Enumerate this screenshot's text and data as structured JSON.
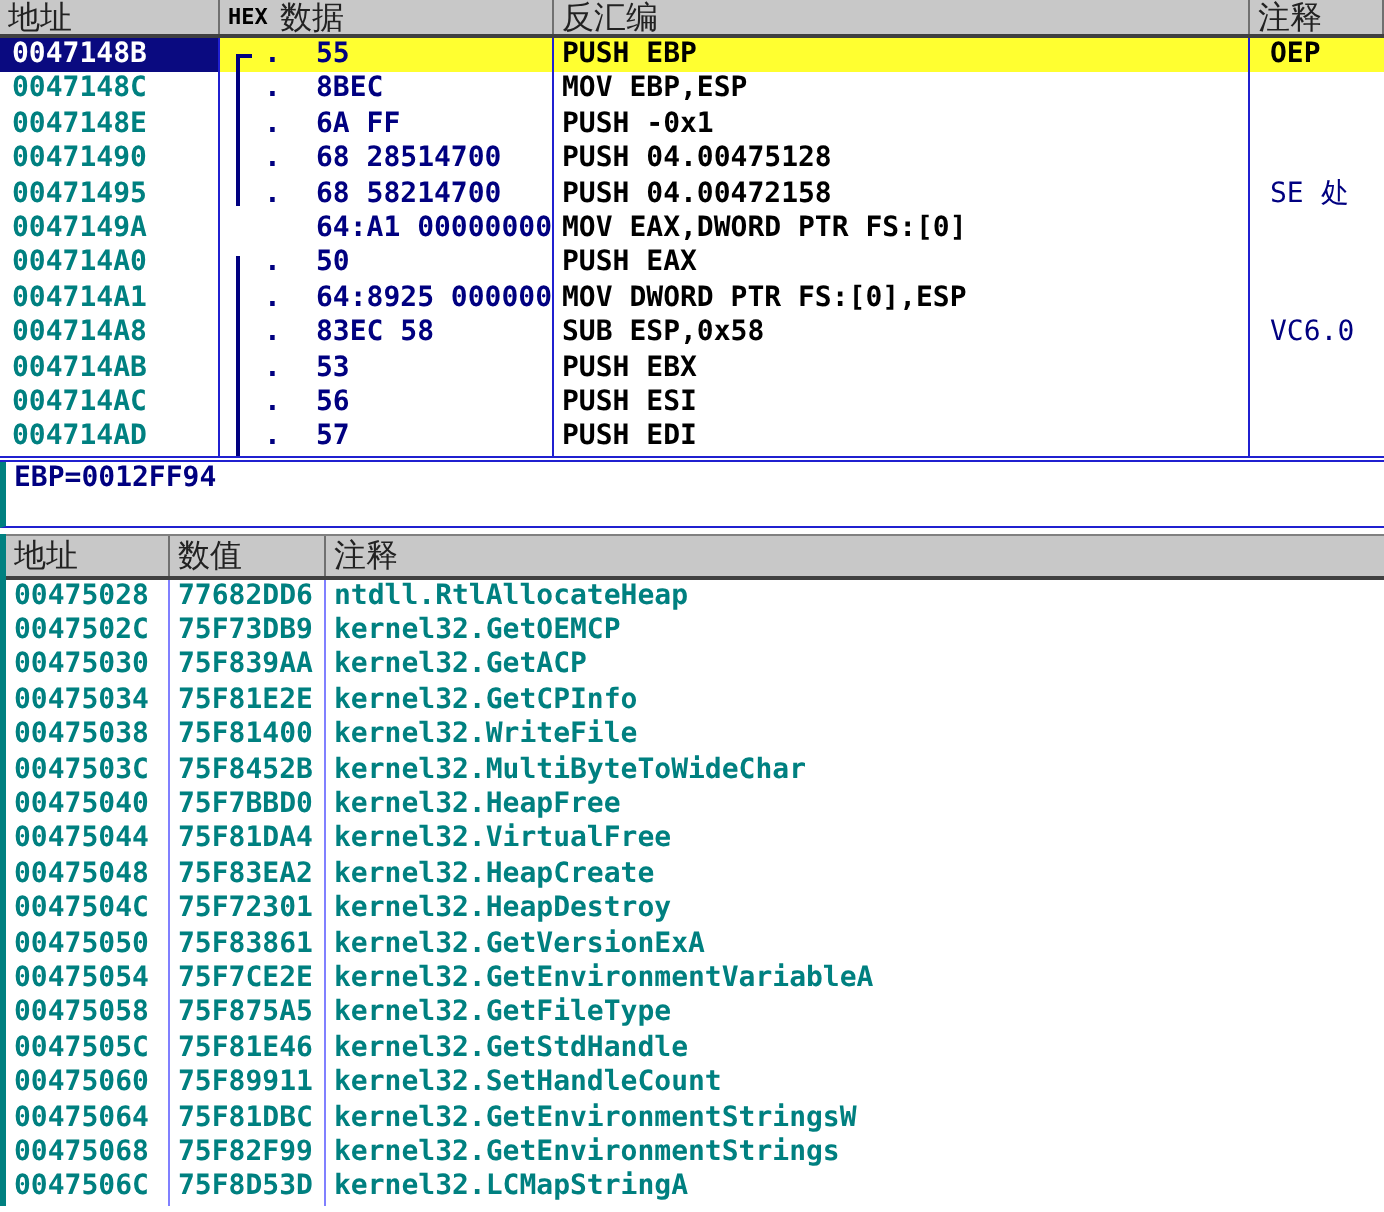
{
  "disassembly": {
    "columns": [
      {
        "label": "地址"
      },
      {
        "tag": "HEX",
        "label": "数据"
      },
      {
        "label": "反汇编"
      },
      {
        "label": "注释"
      }
    ],
    "rows": [
      {
        "address": "0047148B",
        "selected": true,
        "kind": "jumpstart",
        "dot": ".",
        "hex": "55",
        "disasm": "PUSH EBP",
        "comment": "OEP"
      },
      {
        "address": "0047148C",
        "selected": false,
        "kind": "jumpbody",
        "dot": ".",
        "hex": "8BEC",
        "disasm": "MOV EBP,ESP"
      },
      {
        "address": "0047148E",
        "selected": false,
        "kind": "jumpbody",
        "dot": ".",
        "hex": "6A FF",
        "disasm": "PUSH -0x1"
      },
      {
        "address": "00471490",
        "selected": false,
        "kind": "jumpbody",
        "dot": ".",
        "hex": "68 28514700",
        "disasm": "PUSH 04.00475128"
      },
      {
        "address": "00471495",
        "selected": false,
        "kind": "jumpend",
        "dot": ".",
        "hex": "68 58214700",
        "disasm": "PUSH 04.00472158",
        "comment": "SE 处"
      },
      {
        "address": "0047149A",
        "selected": false,
        "kind": "plain",
        "hex": "64:A1 00000000",
        "disasm": "MOV EAX,DWORD PTR FS:[0]"
      },
      {
        "address": "004714A0",
        "selected": false,
        "kind": "blockstart",
        "dot": ".",
        "hex": "50",
        "disasm": "PUSH EAX"
      },
      {
        "address": "004714A1",
        "selected": false,
        "kind": "blockbody",
        "dot": ".",
        "hex": "64:8925 000000",
        "disasm": "MOV DWORD PTR FS:[0],ESP"
      },
      {
        "address": "004714A8",
        "selected": false,
        "kind": "blockbody",
        "dot": ".",
        "hex": "83EC 58",
        "disasm": "SUB ESP,0x58",
        "comment": "VC6.0"
      },
      {
        "address": "004714AB",
        "selected": false,
        "kind": "blockbody",
        "dot": ".",
        "hex": "53",
        "disasm": "PUSH EBX"
      },
      {
        "address": "004714AC",
        "selected": false,
        "kind": "blockbody",
        "dot": ".",
        "hex": "56",
        "disasm": "PUSH ESI"
      },
      {
        "address": "004714AD",
        "selected": false,
        "kind": "blockbody",
        "dot": ".",
        "hex": "57",
        "disasm": "PUSH EDI"
      }
    ]
  },
  "info": "EBP=0012FF94",
  "dump": {
    "columns": [
      "地址",
      "数值",
      "注释"
    ],
    "rows": [
      [
        "00475028",
        "77682DD6",
        "ntdll.RtlAllocateHeap"
      ],
      [
        "0047502C",
        "75F73DB9",
        "kernel32.GetOEMCP"
      ],
      [
        "00475030",
        "75F839AA",
        "kernel32.GetACP"
      ],
      [
        "00475034",
        "75F81E2E",
        "kernel32.GetCPInfo"
      ],
      [
        "00475038",
        "75F81400",
        "kernel32.WriteFile"
      ],
      [
        "0047503C",
        "75F8452B",
        "kernel32.MultiByteToWideChar"
      ],
      [
        "00475040",
        "75F7BBD0",
        "kernel32.HeapFree"
      ],
      [
        "00475044",
        "75F81DA4",
        "kernel32.VirtualFree"
      ],
      [
        "00475048",
        "75F83EA2",
        "kernel32.HeapCreate"
      ],
      [
        "0047504C",
        "75F72301",
        "kernel32.HeapDestroy"
      ],
      [
        "00475050",
        "75F83861",
        "kernel32.GetVersionExA"
      ],
      [
        "00475054",
        "75F7CE2E",
        "kernel32.GetEnvironmentVariableA"
      ],
      [
        "00475058",
        "75F875A5",
        "kernel32.GetFileType"
      ],
      [
        "0047505C",
        "75F81E46",
        "kernel32.GetStdHandle"
      ],
      [
        "00475060",
        "75F89911",
        "kernel32.SetHandleCount"
      ],
      [
        "00475064",
        "75F81DBC",
        "kernel32.GetEnvironmentStringsW"
      ],
      [
        "00475068",
        "75F82F99",
        "kernel32.GetEnvironmentStrings"
      ],
      [
        "0047506C",
        "75F8D53D",
        "kernel32.LCMapStringA"
      ]
    ]
  }
}
